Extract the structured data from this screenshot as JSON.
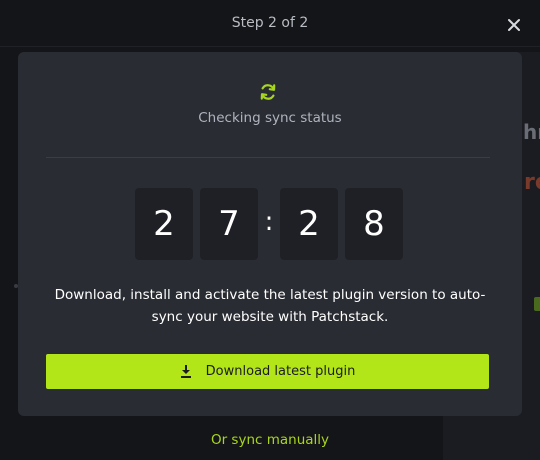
{
  "header": {
    "step_label": "Step 2 of 2"
  },
  "modal": {
    "status_text": "Checking sync status",
    "timer": {
      "digits": [
        "2",
        "7",
        "2",
        "8"
      ],
      "separator": ":"
    },
    "description": "Download, install and activate the latest plugin version to auto-sync your website with Patchstack.",
    "download_button_label": "Download latest plugin"
  },
  "footer": {
    "alt_action_label": "Or sync manually"
  },
  "background": {
    "partial_text_1": "hre",
    "partial_text_2": "ro"
  },
  "colors": {
    "accent": "#b3e618",
    "modal_bg": "#2a2c33",
    "page_bg": "#141519"
  },
  "icons": {
    "sync": "sync-icon",
    "close": "close-icon",
    "download": "download-icon"
  }
}
